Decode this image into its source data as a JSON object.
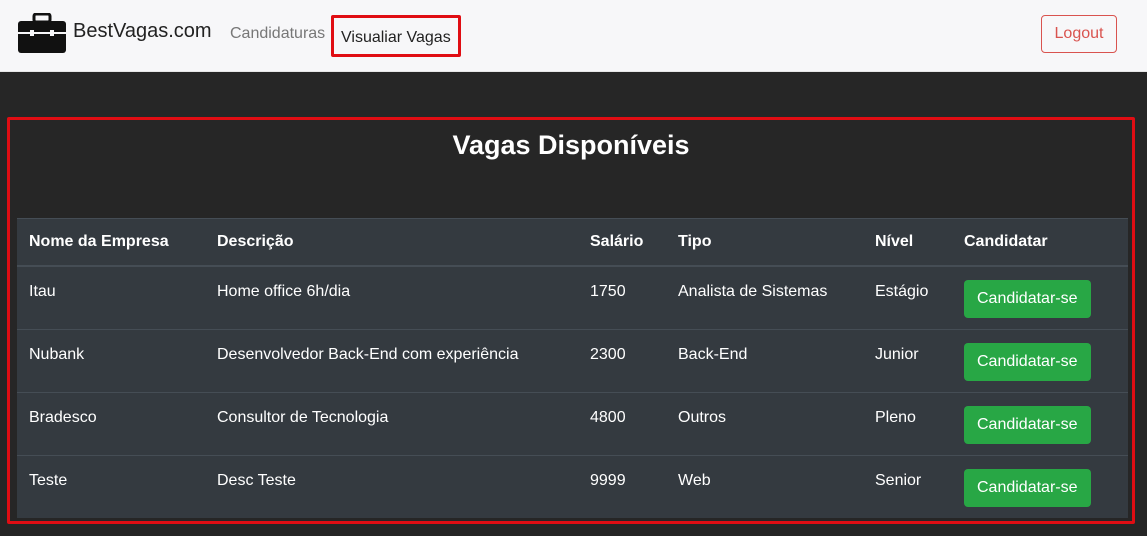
{
  "navbar": {
    "brand": "BestVagas.com",
    "brand_icon": "briefcase-icon",
    "links": [
      {
        "label": "Candidaturas"
      },
      {
        "label": "Visualiar Vagas"
      }
    ],
    "logout_label": "Logout",
    "colors": {
      "highlight": "#e00d13",
      "logout": "#d9534f"
    }
  },
  "main": {
    "title": "Vagas Disponíveis",
    "table": {
      "headers": [
        "Nome da Empresa",
        "Descrição",
        "Salário",
        "Tipo",
        "Nível",
        "Candidatar"
      ],
      "rows": [
        {
          "empresa": "Itau",
          "descricao": "Home office 6h/dia",
          "salario": "1750",
          "tipo": "Analista de Sistemas",
          "nivel": "Estágio",
          "action": "Candidatar-se"
        },
        {
          "empresa": "Nubank",
          "descricao": "Desenvolvedor Back-End com experiência",
          "salario": "2300",
          "tipo": "Back-End",
          "nivel": "Junior",
          "action": "Candidatar-se"
        },
        {
          "empresa": "Bradesco",
          "descricao": "Consultor de Tecnologia",
          "salario": "4800",
          "tipo": "Outros",
          "nivel": "Pleno",
          "action": "Candidatar-se"
        },
        {
          "empresa": "Teste",
          "descricao": "Desc Teste",
          "salario": "9999",
          "tipo": "Web",
          "nivel": "Senior",
          "action": "Candidatar-se"
        }
      ]
    },
    "colors": {
      "apply_button": "#28a745",
      "table_bg": "#343a40"
    }
  }
}
